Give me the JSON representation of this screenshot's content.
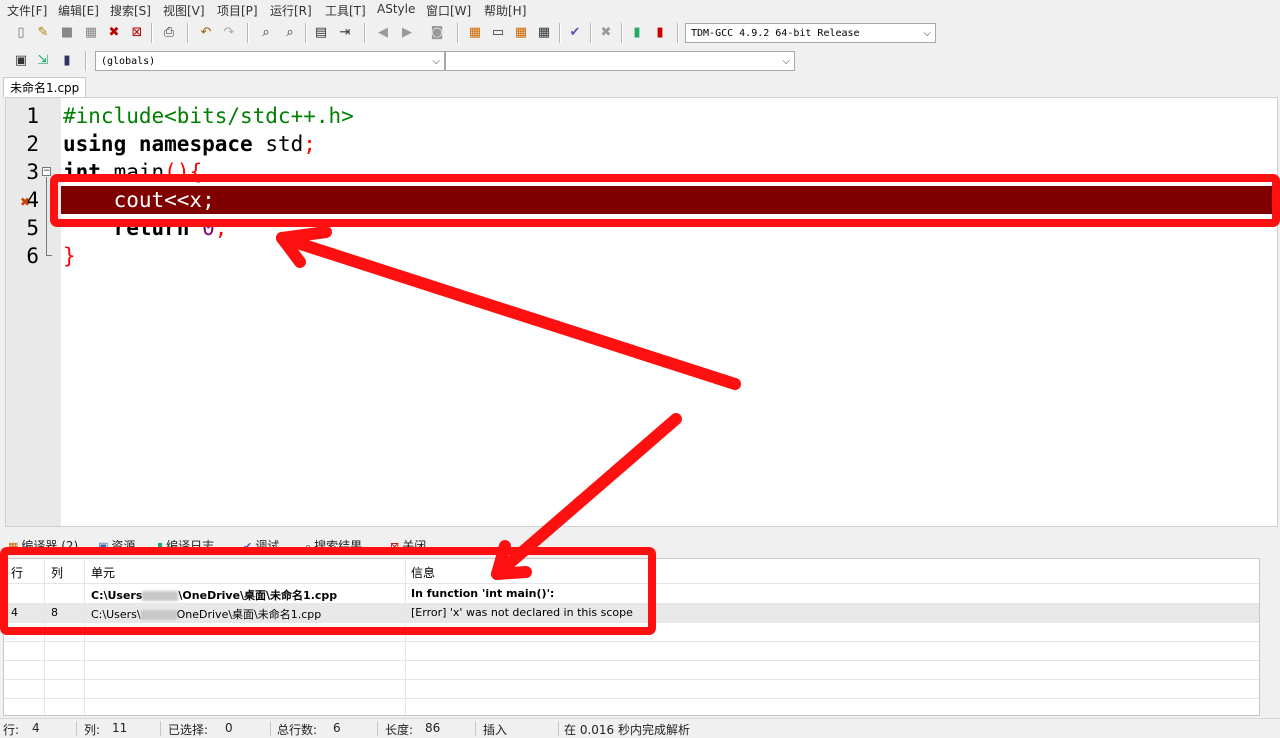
{
  "menu": [
    "文件[F]",
    "编辑[E]",
    "搜索[S]",
    "视图[V]",
    "项目[P]",
    "运行[R]",
    "工具[T]",
    "AStyle",
    "窗口[W]",
    "帮助[H]"
  ],
  "toolbar": {
    "compiler_select": "TDM-GCC 4.9.2 64-bit Release",
    "scope_select": "(globals)",
    "member_select": ""
  },
  "file_tab": "未命名1.cpp",
  "editor": {
    "line_numbers": [
      "1",
      "2",
      "3",
      "4",
      "5",
      "6"
    ],
    "line1": {
      "pre": "#include<bits/stdc++.h>"
    },
    "line2": {
      "kw1": "using",
      "kw2": "namespace",
      "id": "std",
      "semi": ";"
    },
    "line3": {
      "kw": "int",
      "id": "main",
      "sym": "(){"
    },
    "line4": {
      "text": "    cout<<x;"
    },
    "line5": {
      "kw": "return",
      "num": "0",
      "semi": ";"
    },
    "line6": {
      "sym": "}"
    }
  },
  "panel_tabs": [
    "编译器 (2)",
    "资源",
    "编译日志",
    "调试",
    "搜索结果",
    "关闭"
  ],
  "compiler": {
    "headers": {
      "row": "行",
      "col": "列",
      "unit": "单元",
      "info": "信息"
    },
    "rows": [
      {
        "row": "",
        "col": "",
        "unit_prefix": "C:\\Users",
        "unit_suffix": "\\OneDrive\\桌面\\未命名1.cpp",
        "info": "In function 'int main()':"
      },
      {
        "row": "4",
        "col": "8",
        "unit_prefix": "C:\\Users\\",
        "unit_suffix": "OneDrive\\桌面\\未命名1.cpp",
        "info": "[Error] 'x' was not declared in this scope"
      }
    ]
  },
  "status": {
    "line_label": "行:",
    "line_value": "4",
    "col_label": "列:",
    "col_value": "11",
    "sel_label": "已选择:",
    "sel_value": "0",
    "total_label": "总行数:",
    "total_value": "6",
    "len_label": "长度:",
    "len_value": "86",
    "mode": "插入",
    "parse_msg": "在 0.016 秒内完成解析"
  },
  "colors": {
    "annotation": "#ff1010",
    "error_line": "#800000",
    "preprocessor": "#008000",
    "symbol": "#ff0000",
    "number": "#800080"
  }
}
